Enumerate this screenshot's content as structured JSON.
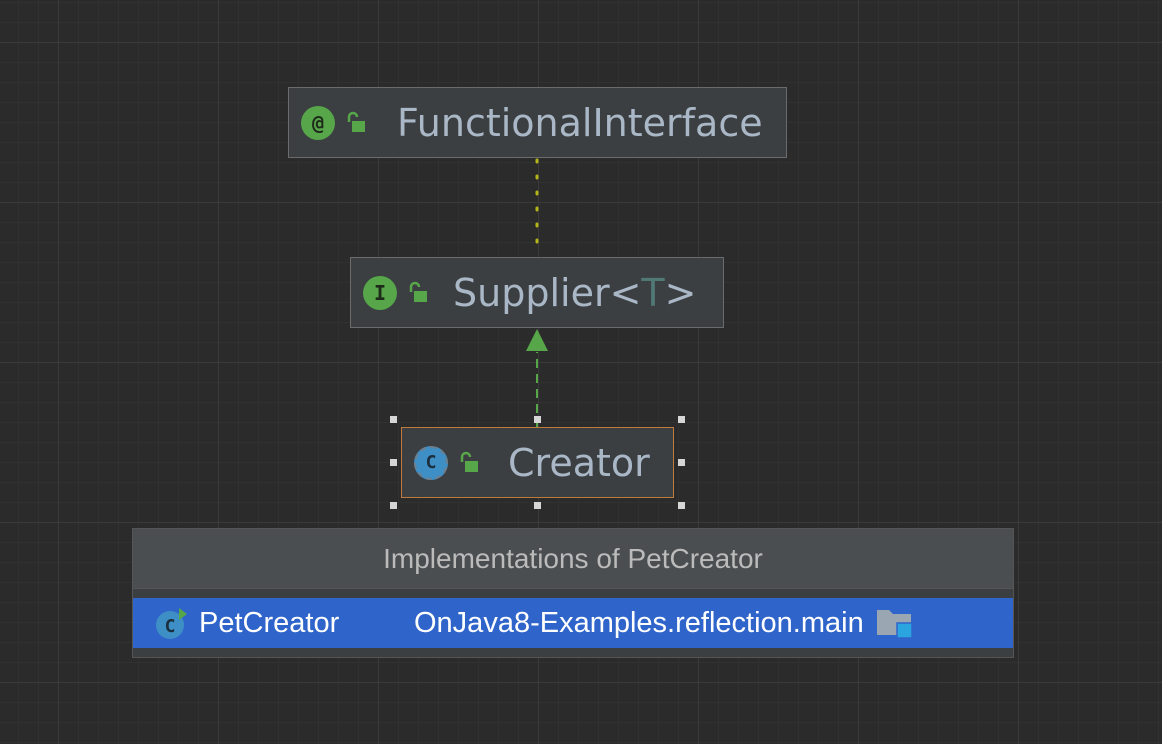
{
  "diagram": {
    "nodes": [
      {
        "id": "functional_interface",
        "badge": "@",
        "label": "FunctionalInterface",
        "kind": "annotation"
      },
      {
        "id": "supplier",
        "badge": "I",
        "label": "Supplier<",
        "type_param": "T",
        "label_end": ">",
        "kind": "interface"
      },
      {
        "id": "creator",
        "badge": "C",
        "label": "Creator",
        "kind": "abstract-class",
        "selected": true
      }
    ],
    "edges": [
      {
        "from": "supplier",
        "to": "functional_interface",
        "style": "dotted",
        "color": "#b5b516"
      },
      {
        "from": "creator",
        "to": "supplier",
        "style": "dashed-arrow",
        "color": "#57a64a"
      }
    ]
  },
  "popup": {
    "title": "Implementations of PetCreator",
    "items": [
      {
        "icon": "class-icon",
        "name": "PetCreator",
        "location": "OnJava8-Examples.reflection.main",
        "trailing_icon": "source-folder-icon"
      }
    ]
  },
  "colors": {
    "background": "#2b2b2b",
    "node_fill": "#3c3f41",
    "selected_border": "#c07a3a",
    "selection_row": "#2f65ca",
    "text": "#a9b7c6"
  }
}
